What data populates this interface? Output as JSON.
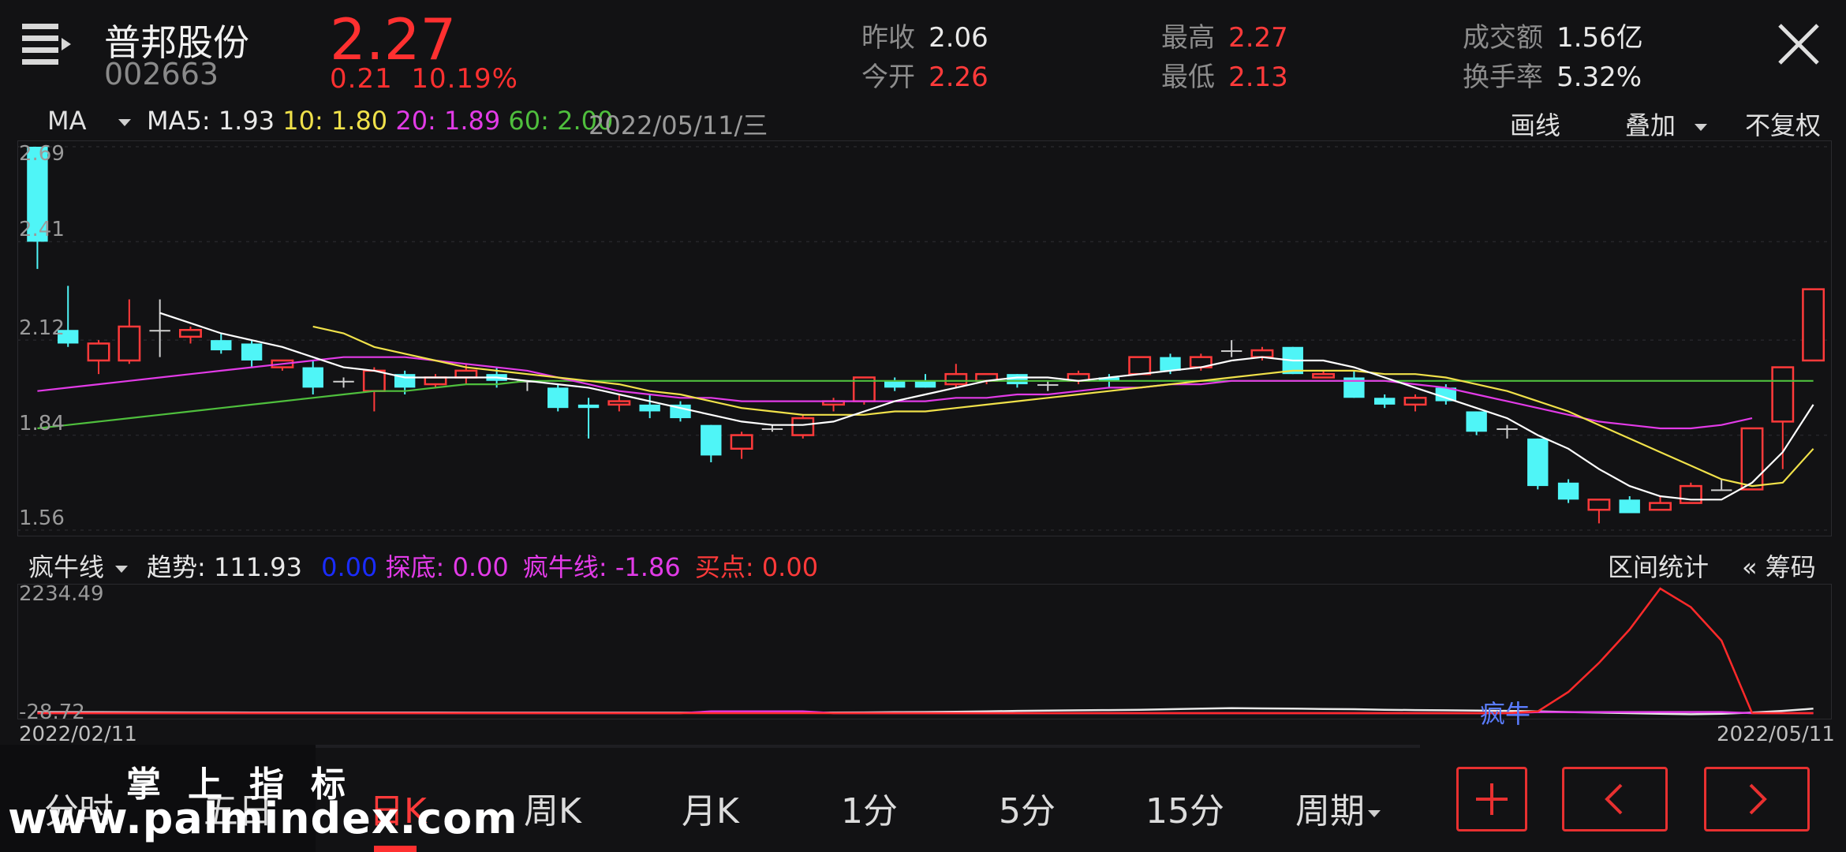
{
  "header": {
    "stock_name": "普邦股份",
    "stock_code": "002663",
    "price": "2.27",
    "change_abs": "0.21",
    "change_pct": "10.19%",
    "stats": [
      {
        "label": "昨收",
        "value": "2.06",
        "color": "#e9e9e9"
      },
      {
        "label": "今开",
        "value": "2.26",
        "color": "#ff3a3a"
      },
      {
        "label": "最高",
        "value": "2.27",
        "color": "#ff3a3a"
      },
      {
        "label": "最低",
        "value": "2.13",
        "color": "#ff3a3a"
      },
      {
        "label": "成交额",
        "value": "1.56亿",
        "color": "#e9e9e9"
      },
      {
        "label": "换手率",
        "value": "5.32%",
        "color": "#e9e9e9"
      }
    ]
  },
  "ma_row": {
    "selector": "MA",
    "ma5": "MA5: 1.93",
    "ma10": "10: 1.80",
    "ma20": "20: 1.89",
    "ma60": "60: 2.00",
    "date": "2022/05/11/三",
    "draw_label": "画线",
    "overlay_label": "叠加",
    "adjust_label": "不复权"
  },
  "indicator_row": {
    "selector": "疯牛线",
    "trend": "趋势: 111.93",
    "blue_val": "0.00",
    "bottom": "探底: 0.00",
    "bull_line": "疯牛线: -1.86",
    "buy_point": "买点: 0.00",
    "range_stats": "区间统计",
    "chips": "« 筹码"
  },
  "chart_data": {
    "type": "candlestick",
    "y_ticks": [
      "2.69",
      "2.41",
      "2.12",
      "1.84",
      "1.56"
    ],
    "ylim": [
      1.56,
      2.69
    ],
    "x_start": "2022/02/11",
    "x_end": "2022/05/11",
    "candles": [
      [
        2.69,
        2.69,
        2.33,
        2.41
      ],
      [
        2.15,
        2.28,
        2.1,
        2.11
      ],
      [
        2.06,
        2.12,
        2.02,
        2.11
      ],
      [
        2.06,
        2.24,
        2.05,
        2.16
      ],
      [
        2.15,
        2.24,
        2.07,
        2.15
      ],
      [
        2.13,
        2.16,
        2.11,
        2.15
      ],
      [
        2.12,
        2.14,
        2.08,
        2.09
      ],
      [
        2.11,
        2.12,
        2.04,
        2.06
      ],
      [
        2.04,
        2.06,
        2.03,
        2.06
      ],
      [
        2.04,
        2.06,
        1.96,
        1.98
      ],
      [
        2.0,
        2.01,
        1.98,
        2.0
      ],
      [
        1.97,
        2.04,
        1.91,
        2.03
      ],
      [
        2.02,
        2.03,
        1.96,
        1.98
      ],
      [
        1.99,
        2.02,
        1.98,
        2.01
      ],
      [
        2.01,
        2.05,
        1.99,
        2.03
      ],
      [
        2.02,
        2.04,
        1.98,
        2.0
      ],
      [
        2.0,
        2.0,
        1.97,
        2.0
      ],
      [
        1.98,
        1.99,
        1.91,
        1.92
      ],
      [
        1.93,
        1.95,
        1.83,
        1.92
      ],
      [
        1.93,
        1.96,
        1.91,
        1.94
      ],
      [
        1.93,
        1.96,
        1.89,
        1.91
      ],
      [
        1.93,
        1.94,
        1.88,
        1.89
      ],
      [
        1.87,
        1.87,
        1.76,
        1.78
      ],
      [
        1.8,
        1.85,
        1.77,
        1.84
      ],
      [
        1.86,
        1.87,
        1.85,
        1.86
      ],
      [
        1.84,
        1.9,
        1.83,
        1.89
      ],
      [
        1.93,
        1.95,
        1.91,
        1.94
      ],
      [
        1.94,
        2.01,
        1.93,
        2.01
      ],
      [
        2.0,
        2.01,
        1.97,
        1.98
      ],
      [
        2.0,
        2.02,
        1.98,
        1.98
      ],
      [
        1.99,
        2.05,
        1.98,
        2.02
      ],
      [
        2.0,
        2.02,
        1.99,
        2.02
      ],
      [
        2.02,
        2.02,
        1.98,
        1.99
      ],
      [
        1.99,
        2.0,
        1.97,
        1.99
      ],
      [
        2.0,
        2.03,
        1.99,
        2.02
      ],
      [
        2.01,
        2.02,
        1.98,
        2.0
      ],
      [
        2.02,
        2.07,
        2.02,
        2.07
      ],
      [
        2.07,
        2.08,
        2.02,
        2.03
      ],
      [
        2.04,
        2.08,
        2.03,
        2.07
      ],
      [
        2.09,
        2.12,
        2.07,
        2.09
      ],
      [
        2.07,
        2.1,
        2.06,
        2.09
      ],
      [
        2.1,
        2.1,
        2.02,
        2.02
      ],
      [
        2.01,
        2.03,
        2.01,
        2.02
      ],
      [
        2.01,
        2.03,
        1.95,
        1.95
      ],
      [
        1.95,
        1.96,
        1.92,
        1.93
      ],
      [
        1.93,
        1.96,
        1.91,
        1.95
      ],
      [
        1.98,
        1.99,
        1.93,
        1.94
      ],
      [
        1.91,
        1.91,
        1.84,
        1.85
      ],
      [
        1.86,
        1.87,
        1.83,
        1.86
      ],
      [
        1.83,
        1.83,
        1.68,
        1.69
      ],
      [
        1.7,
        1.71,
        1.64,
        1.65
      ],
      [
        1.62,
        1.65,
        1.58,
        1.65
      ],
      [
        1.65,
        1.66,
        1.61,
        1.61
      ],
      [
        1.62,
        1.66,
        1.62,
        1.64
      ],
      [
        1.64,
        1.7,
        1.64,
        1.69
      ],
      [
        1.68,
        1.71,
        1.68,
        1.68
      ],
      [
        1.68,
        1.84,
        1.68,
        1.86
      ],
      [
        1.88,
        2.04,
        1.74,
        2.04
      ],
      [
        2.06,
        2.27,
        2.13,
        2.27
      ]
    ],
    "ma5": [
      null,
      null,
      null,
      null,
      2.2,
      2.17,
      2.14,
      2.12,
      2.1,
      2.07,
      2.04,
      2.03,
      2.01,
      2.01,
      2.01,
      2.01,
      2.0,
      1.99,
      1.98,
      1.96,
      1.94,
      1.92,
      1.9,
      1.88,
      1.87,
      1.87,
      1.88,
      1.91,
      1.94,
      1.96,
      1.98,
      2.0,
      2.01,
      2.01,
      2.0,
      2.01,
      2.02,
      2.03,
      2.04,
      2.06,
      2.07,
      2.06,
      2.06,
      2.04,
      2.01,
      1.98,
      1.95,
      1.92,
      1.89,
      1.84,
      1.8,
      1.74,
      1.69,
      1.66,
      1.65,
      1.65,
      1.7,
      1.79,
      1.93
    ],
    "ma10": [
      null,
      null,
      null,
      null,
      null,
      null,
      null,
      null,
      null,
      2.16,
      2.14,
      2.1,
      2.08,
      2.06,
      2.04,
      2.03,
      2.02,
      2.01,
      2.0,
      1.99,
      1.97,
      1.96,
      1.94,
      1.92,
      1.91,
      1.9,
      1.9,
      1.9,
      1.91,
      1.91,
      1.92,
      1.93,
      1.94,
      1.95,
      1.96,
      1.97,
      1.98,
      1.99,
      2.0,
      2.01,
      2.02,
      2.03,
      2.03,
      2.03,
      2.02,
      2.02,
      2.01,
      1.99,
      1.97,
      1.94,
      1.91,
      1.87,
      1.83,
      1.79,
      1.75,
      1.71,
      1.69,
      1.7,
      1.8
    ],
    "ma20": [
      1.97,
      1.98,
      1.99,
      2.0,
      2.01,
      2.02,
      2.03,
      2.04,
      2.05,
      2.06,
      2.07,
      2.07,
      2.07,
      2.06,
      2.05,
      2.04,
      2.03,
      2.01,
      1.99,
      1.97,
      1.96,
      1.95,
      1.95,
      1.94,
      1.94,
      1.94,
      1.94,
      1.94,
      1.94,
      1.94,
      1.95,
      1.95,
      1.96,
      1.96,
      1.97,
      1.98,
      1.98,
      1.99,
      1.99,
      2.0,
      2.0,
      2.0,
      2.0,
      2.0,
      2.0,
      1.99,
      1.98,
      1.96,
      1.94,
      1.92,
      1.9,
      1.88,
      1.87,
      1.86,
      1.86,
      1.87,
      1.89
    ],
    "ma60": [
      1.86,
      1.87,
      1.88,
      1.89,
      1.9,
      1.91,
      1.92,
      1.93,
      1.94,
      1.95,
      1.96,
      1.97,
      1.97,
      1.98,
      1.99,
      1.99,
      2.0,
      2.0,
      2.0,
      2.0,
      2.0,
      2.0,
      2.0,
      2.0,
      2.0,
      2.0,
      2.0,
      2.0,
      2.0,
      2.0,
      2.0,
      2.0,
      2.0,
      2.0,
      2.0,
      2.0,
      2.0,
      2.0,
      2.0,
      2.0,
      2.0,
      2.0,
      2.0,
      2.0,
      2.0,
      2.0,
      2.0,
      2.0,
      2.0,
      2.0,
      2.0,
      2.0,
      2.0,
      2.0,
      2.0,
      2.0,
      2.0,
      2.0,
      2.0
    ]
  },
  "indicator_chart": {
    "y_top": "2234.49",
    "y_bottom": "-28.72",
    "x_start": "2022/02/11",
    "x_end": "2022/05/11",
    "annotation": "疯牛",
    "red_line": [
      0,
      0,
      0,
      0,
      0,
      0,
      0,
      0,
      0,
      0,
      0,
      0,
      0,
      0,
      0,
      0,
      0,
      0,
      0,
      0,
      0,
      0,
      0,
      0,
      0,
      0,
      0,
      0,
      0,
      0,
      0,
      0,
      0,
      0,
      0,
      0,
      0,
      0,
      0,
      0,
      0,
      0,
      0,
      0,
      0,
      0,
      0,
      0,
      0,
      30,
      380,
      900,
      1500,
      2234,
      1900,
      1300,
      0,
      0,
      0
    ],
    "white_line": [
      20,
      18,
      16,
      15,
      14,
      13,
      12,
      11,
      10,
      10,
      10,
      9,
      9,
      9,
      8,
      8,
      8,
      8,
      8,
      8,
      8,
      8,
      8,
      8,
      8,
      8,
      10,
      12,
      16,
      20,
      25,
      30,
      40,
      45,
      50,
      55,
      60,
      70,
      80,
      90,
      85,
      80,
      75,
      70,
      60,
      55,
      50,
      45,
      40,
      30,
      20,
      10,
      0,
      -10,
      -20,
      -10,
      10,
      40,
      80
    ],
    "magenta_line": [
      0,
      0,
      0,
      0,
      0,
      0,
      0,
      0,
      0,
      0,
      0,
      0,
      0,
      0,
      0,
      0,
      0,
      0,
      0,
      0,
      0,
      0,
      30,
      30,
      30,
      30,
      0,
      0,
      0,
      0,
      0,
      0,
      0,
      0,
      0,
      0,
      0,
      0,
      0,
      0,
      0,
      0,
      0,
      0,
      0,
      0,
      0,
      0,
      0,
      20,
      20,
      20,
      20,
      20,
      20,
      20,
      0,
      0,
      0
    ]
  },
  "tabs": [
    "分时",
    "五日",
    "日K",
    "周K",
    "月K",
    "1分",
    "5分",
    "15分",
    "周期"
  ],
  "active_tab": "日K",
  "watermark_cn": "掌上指标",
  "watermark_url": "www.palmindex.com",
  "icons": [
    "menu-icon",
    "close-icon",
    "plus-icon",
    "chevron-left-icon",
    "chevron-right-icon"
  ]
}
